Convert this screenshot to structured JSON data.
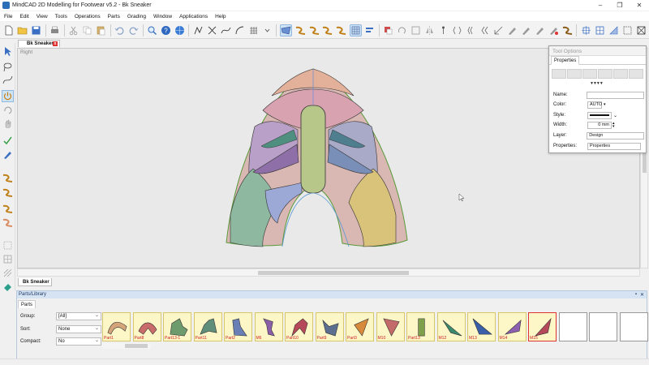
{
  "window": {
    "title": "MindCAD 2D Modelling for Footwear v5.2 - Bk Sneaker",
    "minimize": "–",
    "maximize": "❐",
    "close": "✕"
  },
  "menu": [
    "File",
    "Edit",
    "View",
    "Tools",
    "Operations",
    "Parts",
    "Grading",
    "Window",
    "Applications",
    "Help"
  ],
  "document": {
    "tab_label": "Bk Sneaker",
    "tab_close": "x",
    "view_label": "Right",
    "bottom_tab_label": "Bk Sneaker"
  },
  "tool_options": {
    "header": "Tool Options",
    "tab": "Properties",
    "arrows": "▼▼▼▼",
    "name_label": "Name:",
    "name_value": "",
    "color_label": "Color:",
    "color_value": "AUTO",
    "style_label": "Style:",
    "width_label": "Width:",
    "width_value": "0 mm",
    "layer_label": "Layer:",
    "layer_value": "Design",
    "properties_label": "Properties:",
    "properties_value": "Properties"
  },
  "parts_library": {
    "header": "Parts/Library",
    "pin": "▪",
    "close": "✕",
    "tab": "Parts",
    "group_label": "Group:",
    "group_value": "[All]",
    "sort_label": "Sort:",
    "sort_value": "None",
    "compact_label": "Compact:",
    "compact_value": "No",
    "parts": [
      {
        "name": "Part1",
        "color": "#d4a57a"
      },
      {
        "name": "Part8",
        "color": "#c96b6b"
      },
      {
        "name": "Part13-1",
        "color": "#6e9b6e"
      },
      {
        "name": "Part11",
        "color": "#5f8f7a"
      },
      {
        "name": "Part2",
        "color": "#6a7fb5"
      },
      {
        "name": "M6",
        "color": "#8b5fa8"
      },
      {
        "name": "Part10",
        "color": "#b5495a"
      },
      {
        "name": "Part9",
        "color": "#5c6f8f"
      },
      {
        "name": "Part3",
        "color": "#d88a3c"
      },
      {
        "name": "M10",
        "color": "#c46a6a"
      },
      {
        "name": "Part13",
        "color": "#7fa04a"
      },
      {
        "name": "M12",
        "color": "#3c8a6e"
      },
      {
        "name": "M13",
        "color": "#3a5fa8"
      },
      {
        "name": "M14",
        "color": "#8c5fb0"
      },
      {
        "name": "M15",
        "color": "#b5495a"
      }
    ],
    "empty_slots": 3
  },
  "colors": {
    "selection": "#cfe3f7",
    "part_thumb_bg": "#fdf6c7",
    "panel_header": "#d5e3f3"
  }
}
